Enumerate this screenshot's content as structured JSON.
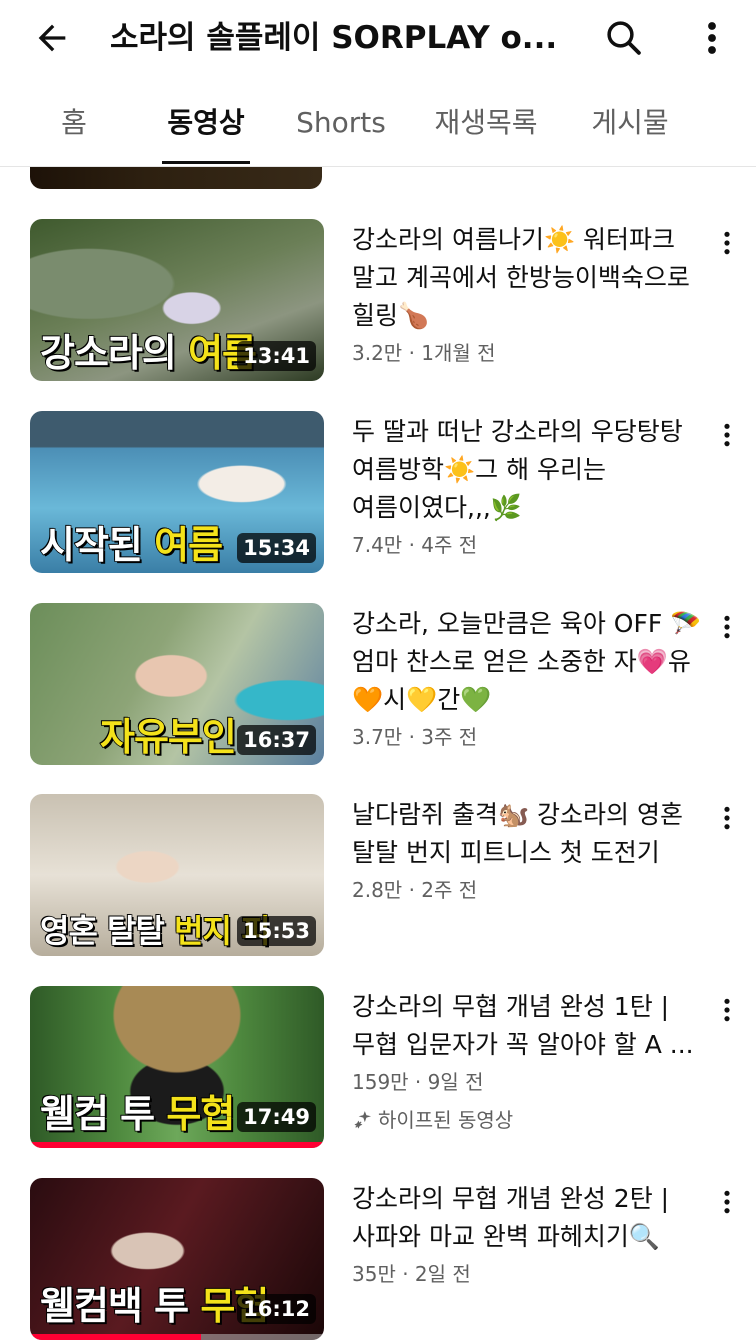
{
  "header": {
    "title": "소라의 솔플레이 SORPLAY o...",
    "back_icon": "arrow-left-icon",
    "search_icon": "search-icon",
    "more_icon": "more-vertical-icon"
  },
  "tabs": [
    {
      "label": "홈",
      "active": false
    },
    {
      "label": "동영상",
      "active": true
    },
    {
      "label": "Shorts",
      "active": false
    },
    {
      "label": "재생목록",
      "active": false
    },
    {
      "label": "게시물",
      "active": false
    }
  ],
  "videos": [
    {
      "title": "강소라의 여름나기☀️ 워터파크 말고 계곡에서 한방능이백숙으로 힐링🍗",
      "meta": "3.2만 · 1개월 전",
      "duration": "13:41",
      "thumb_caption": "강소라의",
      "thumb_caption_highlight": "여름"
    },
    {
      "title": "두 딸과 떠난 강소라의 우당탕탕 여름방학☀️그 해 우리는 여름이였다,,,🌿",
      "meta": "7.4만 · 4주 전",
      "duration": "15:34",
      "thumb_caption": "시작된",
      "thumb_caption_highlight": "여름"
    },
    {
      "title": "강소라, 오늘만큼은 육아 OFF 🪂 엄마 찬스로 얻은 소중한 자💗유🧡시💛간💚",
      "meta": "3.7만 · 3주 전",
      "duration": "16:37",
      "thumb_caption": "",
      "thumb_caption_highlight": "자유부인"
    },
    {
      "title": "날다람쥐 출격🐿️ 강소라의 영혼 탈탈 번지 피트니스 첫 도전기",
      "meta": "2.8만 · 2주 전",
      "duration": "15:53",
      "thumb_caption": "영혼 탈탈",
      "thumb_caption_highlight": "번지 피"
    },
    {
      "title": "강소라의 무협 개념 완성 1탄 | 무협 입문자가 꼭 알아야 할 A ...",
      "meta": "159만 · 9일 전",
      "duration": "17:49",
      "thumb_caption": "웰컴 투",
      "thumb_caption_highlight": "무협",
      "badge": "하이프된 동영상",
      "watch_progress": 1.0
    },
    {
      "title": "강소라의 무협 개념 완성 2탄 | 사파와 마교 완벽 파헤치기🔍",
      "meta": "35만 · 2일 전",
      "duration": "16:12",
      "thumb_caption": "웰컴백 투",
      "thumb_caption_highlight": "무협",
      "watch_progress": 0.58
    }
  ],
  "colors": {
    "text_primary": "#0f0f0f",
    "text_secondary": "#606060",
    "progress": "#ff0033",
    "caption_highlight": "#f4e21a"
  }
}
